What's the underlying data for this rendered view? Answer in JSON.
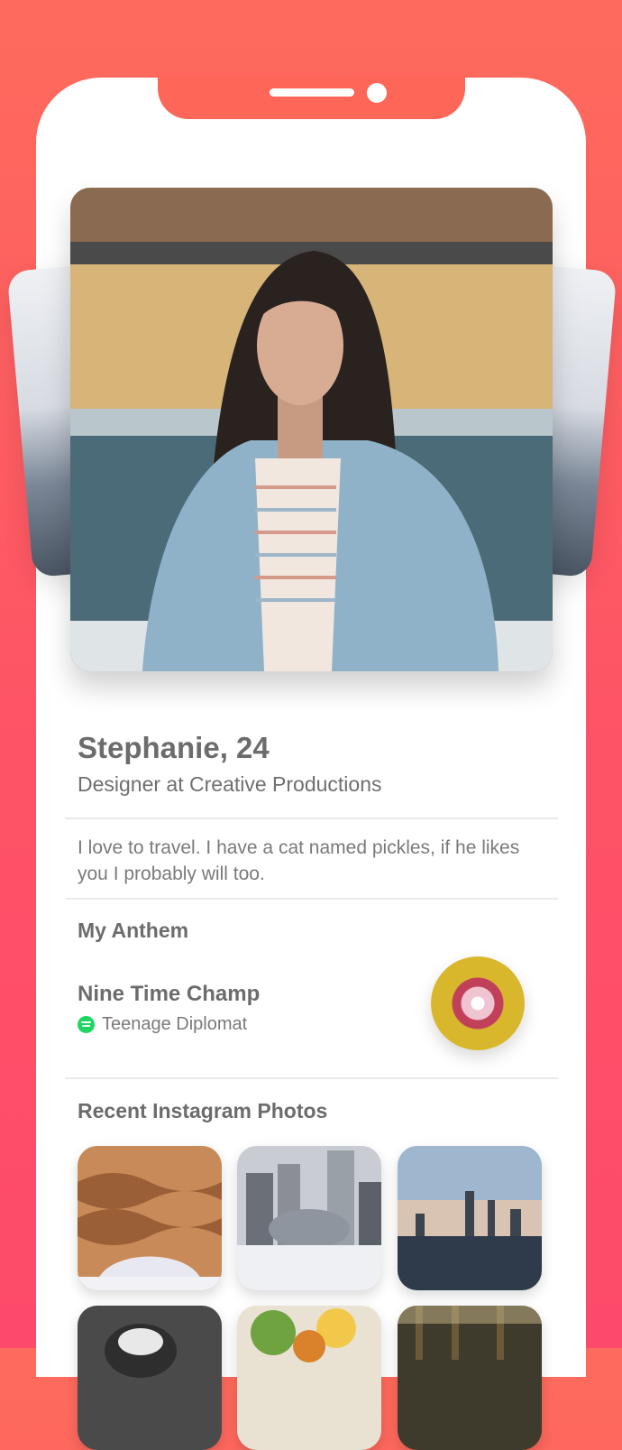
{
  "profile": {
    "name_age": "Stephanie, 24",
    "job": "Designer at Creative Productions",
    "bio": "I love to travel. I have a cat named pickles, if he likes you I probably will too."
  },
  "anthem": {
    "section_title": "My Anthem",
    "song": "Nine Time Champ",
    "artist": "Teenage Diplomat",
    "icon": "spotify-icon"
  },
  "instagram": {
    "section_title": "Recent Instagram Photos",
    "photos": [
      "wooden-pavilion",
      "city-bean-sculpture",
      "city-skyline",
      "food-bowl",
      "salad-plate",
      "forest"
    ]
  },
  "colors": {
    "background_top": "#fe6b5c",
    "background_bottom": "#fd4a6b",
    "spotify": "#1ed760"
  }
}
